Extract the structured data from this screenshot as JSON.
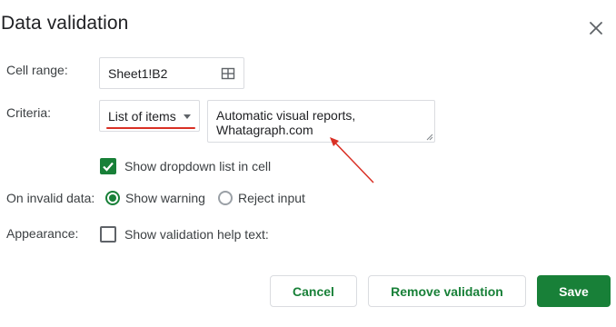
{
  "dialog": {
    "title": "Data validation"
  },
  "cell_range": {
    "label": "Cell range:",
    "value": "Sheet1!B2"
  },
  "criteria": {
    "label": "Criteria:",
    "selected": "List of items",
    "items_text": "Automatic visual reports,\nWhatagraph.com"
  },
  "show_dropdown": {
    "label": "Show dropdown list in cell",
    "checked": true
  },
  "invalid_data": {
    "label": "On invalid data:",
    "options": [
      {
        "label": "Show warning",
        "selected": true
      },
      {
        "label": "Reject input",
        "selected": false
      }
    ]
  },
  "appearance": {
    "label": "Appearance:",
    "checkbox_label": "Show validation help text:",
    "checked": false
  },
  "buttons": {
    "cancel": "Cancel",
    "remove": "Remove validation",
    "save": "Save"
  },
  "colors": {
    "accent": "#188038",
    "annotation": "#d93025"
  },
  "icons": {
    "close": "close-icon",
    "grid": "grid-select-icon",
    "caret": "caret-down-icon",
    "check": "checkmark-icon",
    "arrow": "annotation-arrow"
  }
}
